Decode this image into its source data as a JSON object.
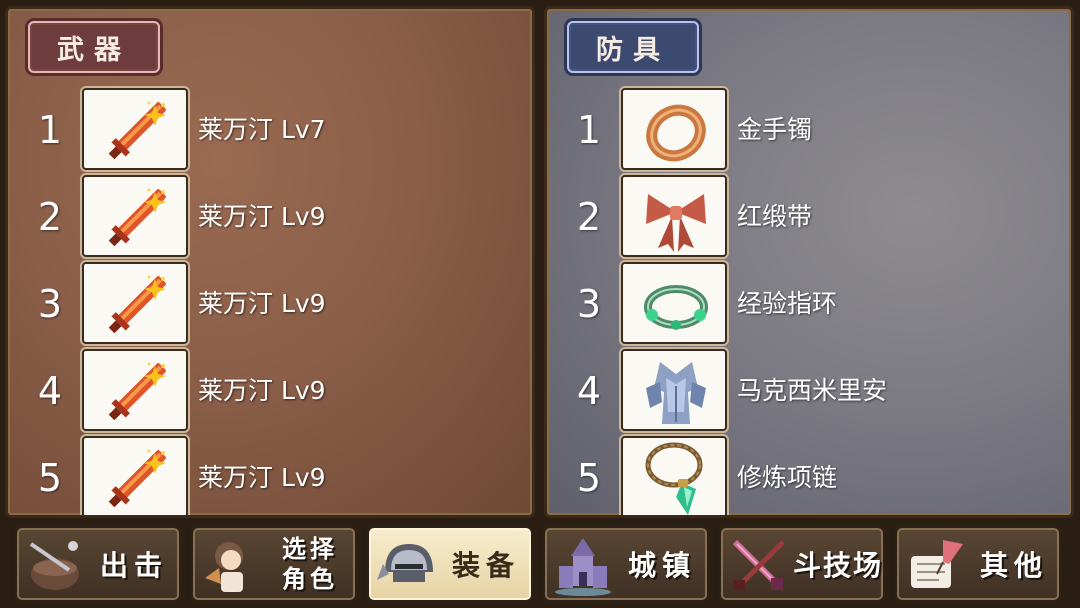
{
  "weapons": {
    "title": "武器",
    "items": [
      {
        "num": "1",
        "name": "莱万汀 Lv7",
        "icon": "flame-sword-icon"
      },
      {
        "num": "2",
        "name": "莱万汀 Lv9",
        "icon": "flame-sword-icon"
      },
      {
        "num": "3",
        "name": "莱万汀 Lv9",
        "icon": "flame-sword-icon"
      },
      {
        "num": "4",
        "name": "莱万汀 Lv9",
        "icon": "flame-sword-icon"
      },
      {
        "num": "5",
        "name": "莱万汀 Lv9",
        "icon": "flame-sword-icon"
      }
    ]
  },
  "armor": {
    "title": "防具",
    "items": [
      {
        "num": "1",
        "name": "金手镯",
        "icon": "bracelet-icon"
      },
      {
        "num": "2",
        "name": "红缎带",
        "icon": "red-ribbon-icon"
      },
      {
        "num": "3",
        "name": "经验指环",
        "icon": "green-ring-icon"
      },
      {
        "num": "4",
        "name": "马克西米里安",
        "icon": "silver-armor-icon"
      },
      {
        "num": "5",
        "name": "修炼项链",
        "icon": "pendant-necklace-icon"
      }
    ]
  },
  "nav": {
    "sortie": "出击",
    "select_line1": "选择",
    "select_line2": "角色",
    "equip": "装备",
    "town": "城镇",
    "arena": "斗技场",
    "other": "其他"
  },
  "colors": {
    "weapon_tag": "#6e3c3c",
    "armor_tag": "#3c4a70",
    "active_button": "#f7edcf"
  }
}
